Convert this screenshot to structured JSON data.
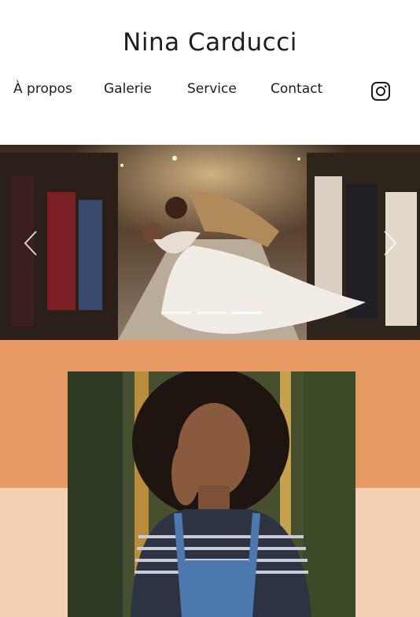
{
  "header": {
    "site_title": "Nina Carducci",
    "nav": [
      "À propos",
      "Galerie",
      "Service",
      "Contact"
    ],
    "social_icon": "instagram-icon"
  },
  "hero": {
    "image": "wedding couple kissing between rows of guests with sparklers",
    "slide_count": 3,
    "active_slide": 3,
    "prev_icon": "chevron-left-icon",
    "next_icon": "chevron-right-icon"
  },
  "about": {
    "image": "portrait of woman with curly hair in striped shirt and denim overalls",
    "colors": {
      "band_top": "#e89a65",
      "band_bottom": "#f6d0b5"
    }
  }
}
